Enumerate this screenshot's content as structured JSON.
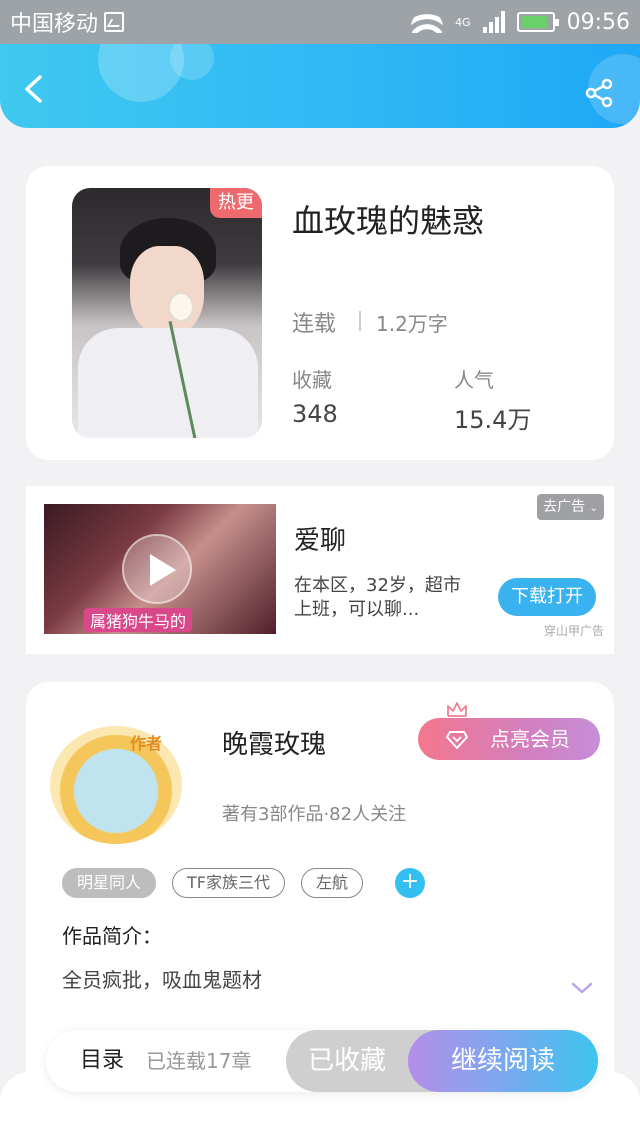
{
  "status_bar": {
    "carrier": "中国移动",
    "network": "4G",
    "time": "09:56"
  },
  "header": {
    "back_icon": "chevron-left-icon",
    "share_icon": "share-icon"
  },
  "book": {
    "badge": "热更",
    "title": "血玫瑰的魅惑",
    "status": "连载",
    "word_count": "1.2万字",
    "favorites_label": "收藏",
    "favorites_value": "348",
    "popularity_label": "人气",
    "popularity_value": "15.4万"
  },
  "ad": {
    "thumb_caption": "属猪狗牛马的",
    "title": "爱聊",
    "description": "在本区，32岁，超市上班，可以聊...",
    "remove_label": "去广告",
    "download_label": "下载打开",
    "source": "穿山甲广告"
  },
  "author": {
    "avatar_tag": "作者",
    "name": "晚霞玫瑰",
    "vip_label": "点亮会员",
    "works": "著有3部作品·82人关注",
    "tags": [
      "明星同人",
      "TF家族三代",
      "左航"
    ],
    "intro_label": "作品简介：",
    "intro_text": "全员疯批，吸血鬼题材"
  },
  "action_bar": {
    "toc_label": "目录",
    "chapter_count": "已连载17章",
    "collected_label": "已收藏",
    "read_label": "继续阅读"
  },
  "colors": {
    "header_start": "#3fc9f0",
    "header_end": "#1ea8f6",
    "hot_badge": "#ef6a6f",
    "download_btn": "#3bb2f0",
    "read_btn_start": "#b48ee8",
    "read_btn_end": "#3cc4ef"
  }
}
